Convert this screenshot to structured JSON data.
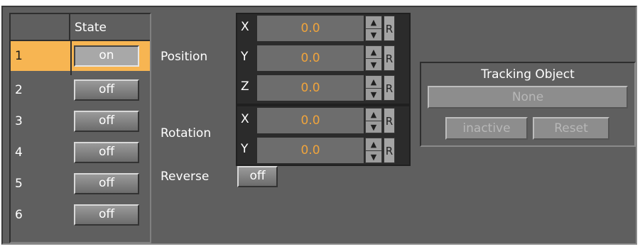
{
  "state_table": {
    "header": "State",
    "rows": [
      {
        "index": "1",
        "state": "on",
        "selected": true
      },
      {
        "index": "2",
        "state": "off",
        "selected": false
      },
      {
        "index": "3",
        "state": "off",
        "selected": false
      },
      {
        "index": "4",
        "state": "off",
        "selected": false
      },
      {
        "index": "5",
        "state": "off",
        "selected": false
      },
      {
        "index": "6",
        "state": "off",
        "selected": false
      }
    ]
  },
  "position": {
    "label": "Position",
    "axes": [
      {
        "axis": "X",
        "value": "0.0",
        "reset": "R"
      },
      {
        "axis": "Y",
        "value": "0.0",
        "reset": "R"
      },
      {
        "axis": "Z",
        "value": "0.0",
        "reset": "R"
      }
    ]
  },
  "rotation": {
    "label": "Rotation",
    "axes": [
      {
        "axis": "X",
        "value": "0.0",
        "reset": "R"
      },
      {
        "axis": "Y",
        "value": "0.0",
        "reset": "R"
      }
    ]
  },
  "reverse": {
    "label": "Reverse",
    "value": "off"
  },
  "tracking": {
    "title": "Tracking Object",
    "object": "None",
    "inactive_label": "inactive",
    "reset_label": "Reset"
  },
  "colors": {
    "panel_bg": "#5f5f5f",
    "selected_row": "#f7b552",
    "value_text": "#f0a43c",
    "value_bg": "#6d6d6d"
  },
  "icons": {
    "spin_up": "triangle-up-icon",
    "spin_down": "triangle-down-icon"
  }
}
